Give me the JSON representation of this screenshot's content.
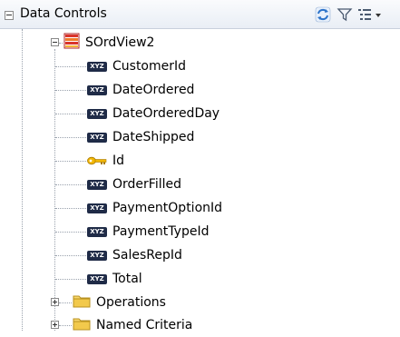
{
  "panel": {
    "title": "Data Controls",
    "refresh_icon": "refresh-icon",
    "filter_icon": "filter-icon",
    "options_icon": "view-options-icon"
  },
  "tree": {
    "root": {
      "label": "SOrdView2",
      "icon": "view-object-icon",
      "expanded": true
    },
    "attributes": [
      {
        "label": "CustomerId",
        "icon": "attribute-icon"
      },
      {
        "label": "DateOrdered",
        "icon": "attribute-icon"
      },
      {
        "label": "DateOrderedDay",
        "icon": "attribute-icon"
      },
      {
        "label": "DateShipped",
        "icon": "attribute-icon"
      },
      {
        "label": "Id",
        "icon": "key-icon"
      },
      {
        "label": "OrderFilled",
        "icon": "attribute-icon"
      },
      {
        "label": "PaymentOptionId",
        "icon": "attribute-icon"
      },
      {
        "label": "PaymentTypeId",
        "icon": "attribute-icon"
      },
      {
        "label": "SalesRepId",
        "icon": "attribute-icon"
      },
      {
        "label": "Total",
        "icon": "attribute-icon"
      }
    ],
    "folders": [
      {
        "label": "Operations",
        "icon": "folder-icon",
        "expanded": false
      },
      {
        "label": "Named Criteria",
        "icon": "folder-icon",
        "expanded": false
      }
    ],
    "attr_icon_text": "XYZ"
  },
  "colors": {
    "header_bg": "#eef2f7",
    "attr_icon": "#1f2b47",
    "folder": "#f2c94c",
    "key": "#d9a400",
    "view_object": "#d9342b"
  }
}
